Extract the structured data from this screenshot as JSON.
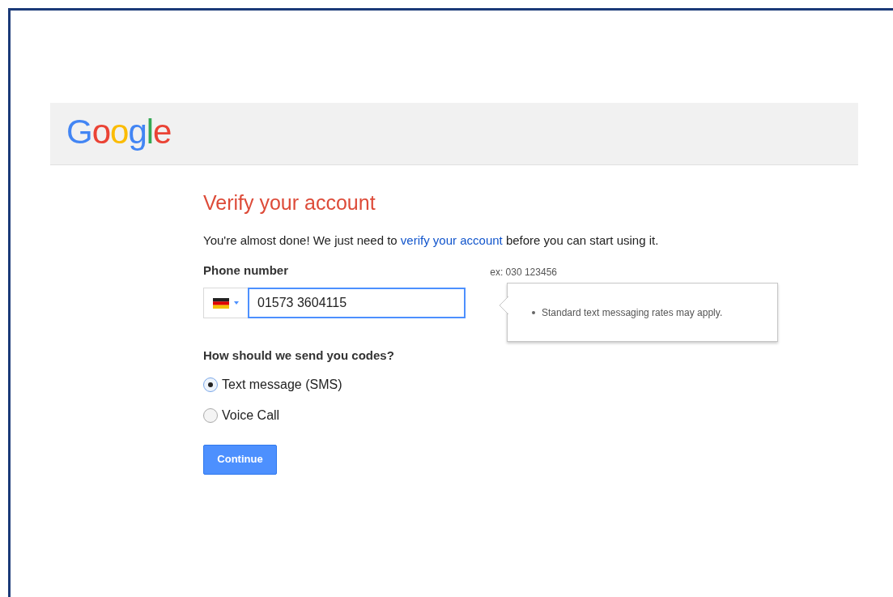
{
  "logo": "Google",
  "heading": "Verify your account",
  "intro": {
    "before": "You're almost done! We just need to ",
    "link": "verify your account",
    "after": " before you can start using it."
  },
  "phone": {
    "label": "Phone number",
    "example": "ex: 030 123456",
    "value": "01573 3604115",
    "focused": true
  },
  "tooltip": {
    "items": [
      "Standard text messaging rates may apply."
    ]
  },
  "method": {
    "question": "How should we send you codes?",
    "options": [
      {
        "label": "Text message (SMS)",
        "selected": true
      },
      {
        "label": "Voice Call",
        "selected": false
      }
    ]
  },
  "button": "Continue"
}
